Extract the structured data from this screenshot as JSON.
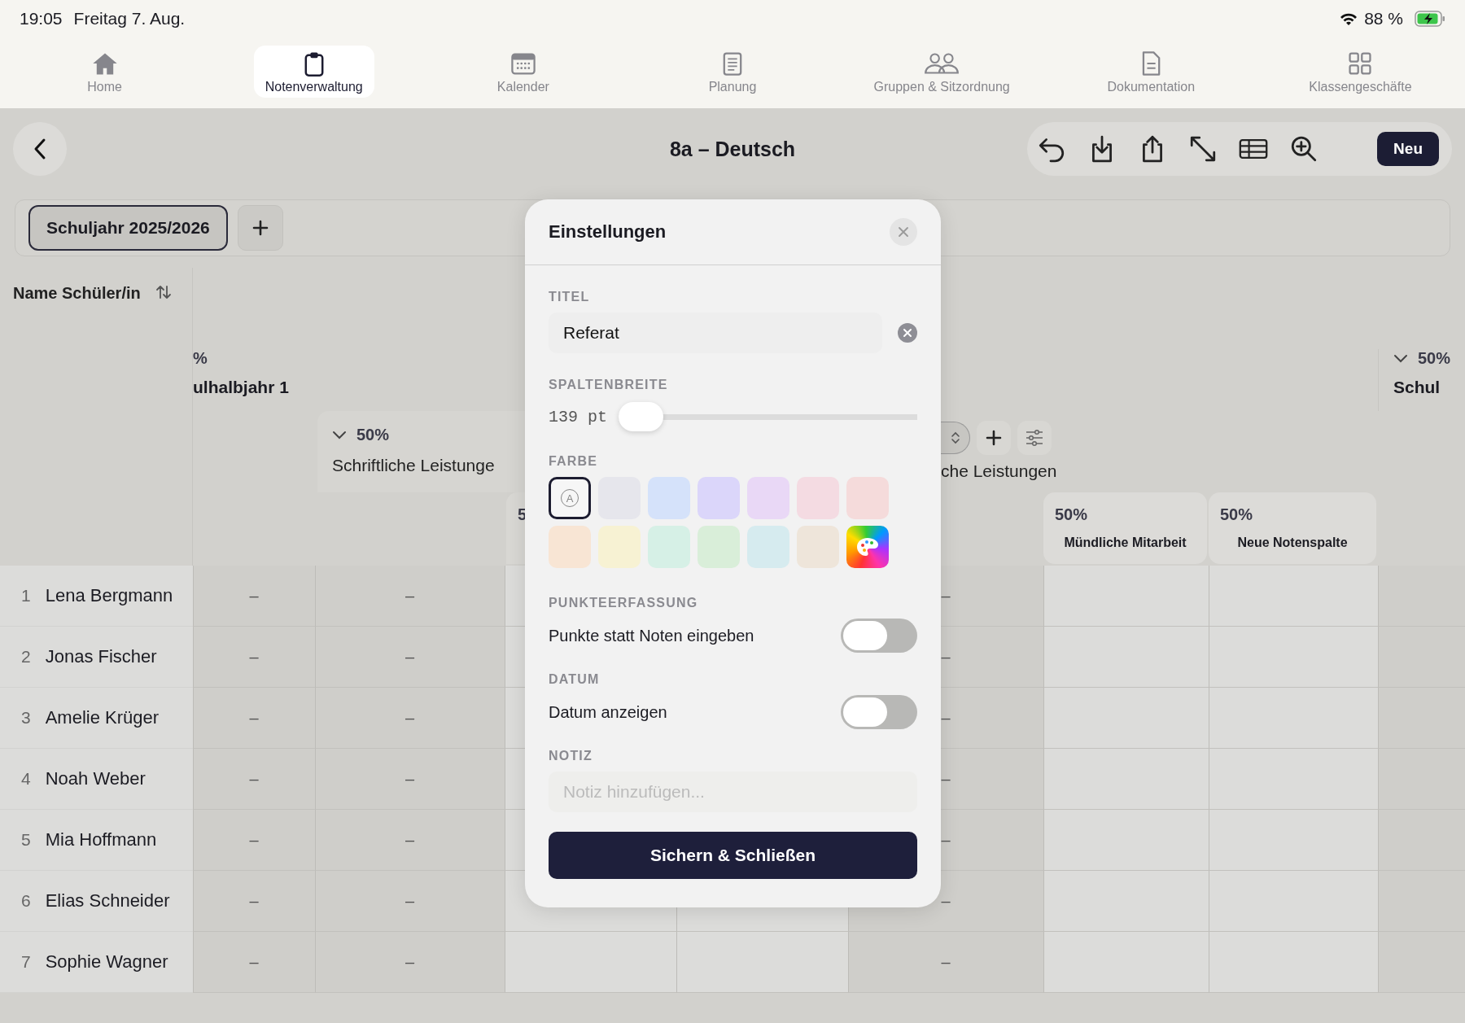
{
  "status_bar": {
    "time": "19:05",
    "date": "Freitag 7. Aug.",
    "battery": "88 %"
  },
  "nav_tabs": [
    {
      "label": "Home",
      "selected": false
    },
    {
      "label": "Notenverwaltung",
      "selected": true
    },
    {
      "label": "Kalender",
      "selected": false
    },
    {
      "label": "Planung",
      "selected": false
    },
    {
      "label": "Gruppen & Sitzordnung",
      "selected": false
    },
    {
      "label": "Dokumentation",
      "selected": false
    },
    {
      "label": "Klassengeschäfte",
      "selected": false
    }
  ],
  "toolbar": {
    "title": "8a – Deutsch",
    "new_button": "Neu"
  },
  "year_tabs": [
    {
      "label": "Schuljahr 2025/2026",
      "selected": true
    }
  ],
  "table": {
    "name_header": "Name Schüler/in",
    "group_left": {
      "weight": "%",
      "title": "ulhalbjahr 1"
    },
    "group_right": {
      "weight": "50%",
      "title": "Schul"
    },
    "subgroup_left": {
      "weight": "50%",
      "title": "Schriftliche Leistunge"
    },
    "subgroup_right": {
      "title": "che Leistungen"
    },
    "partial_column": {
      "weight": "5"
    },
    "columns": [
      {
        "weight": "50%",
        "title": "Mündliche Mitarbeit"
      },
      {
        "weight": "50%",
        "title": "Neue Notenspalte"
      }
    ],
    "rows": [
      {
        "number": "1",
        "name": "Lena Bergmann",
        "grades": [
          "–",
          "–",
          "–"
        ]
      },
      {
        "number": "2",
        "name": "Jonas Fischer",
        "grades": [
          "–",
          "–",
          "–"
        ]
      },
      {
        "number": "3",
        "name": "Amelie Krüger",
        "grades": [
          "–",
          "–",
          "–"
        ]
      },
      {
        "number": "4",
        "name": "Noah Weber",
        "grades": [
          "–",
          "–",
          "–"
        ]
      },
      {
        "number": "5",
        "name": "Mia Hoffmann",
        "grades": [
          "–",
          "–",
          "–"
        ]
      },
      {
        "number": "6",
        "name": "Elias Schneider",
        "grades": [
          "–",
          "–",
          "–"
        ]
      },
      {
        "number": "7",
        "name": "Sophie Wagner",
        "grades": [
          "–",
          "–",
          "–"
        ]
      }
    ]
  },
  "dialog": {
    "title": "Einstellungen",
    "title_label": "TITEL",
    "title_value": "Referat",
    "width_label": "SPALTENBREITE",
    "width_value": "139 pt",
    "width_slider": {
      "level": 0.0
    },
    "color_label": "FARBE",
    "colors": [
      {
        "kind": "auto",
        "label": "A",
        "selected": true
      },
      {
        "kind": "swatch",
        "color": "#e6e6ec",
        "selected": false
      },
      {
        "kind": "swatch",
        "color": "#d5e2fa",
        "selected": false
      },
      {
        "kind": "swatch",
        "color": "#dbd6fa",
        "selected": false
      },
      {
        "kind": "swatch",
        "color": "#e9d8f6",
        "selected": false
      },
      {
        "kind": "swatch",
        "color": "#f4dbe2",
        "selected": false
      },
      {
        "kind": "swatch",
        "color": "#f5dbdb",
        "selected": false
      },
      {
        "kind": "swatch",
        "color": "#f8e5d4",
        "selected": false
      },
      {
        "kind": "swatch",
        "color": "#f7f2d3",
        "selected": false
      },
      {
        "kind": "swatch",
        "color": "#d6f0e6",
        "selected": false
      },
      {
        "kind": "swatch",
        "color": "#d9eed9",
        "selected": false
      },
      {
        "kind": "swatch",
        "color": "#d6ebef",
        "selected": false
      },
      {
        "kind": "swatch",
        "color": "#eee5da",
        "selected": false
      },
      {
        "kind": "custom",
        "selected": false
      }
    ],
    "points_label": "PUNKTEERFASSUNG",
    "points_toggle": {
      "label": "Punkte statt Noten eingeben",
      "on": false
    },
    "date_label": "DATUM",
    "date_toggle": {
      "label": "Datum anzeigen",
      "on": false
    },
    "note_label": "NOTIZ",
    "note_placeholder": "Notiz hinzufügen...",
    "save_button": "Sichern & Schließen"
  }
}
